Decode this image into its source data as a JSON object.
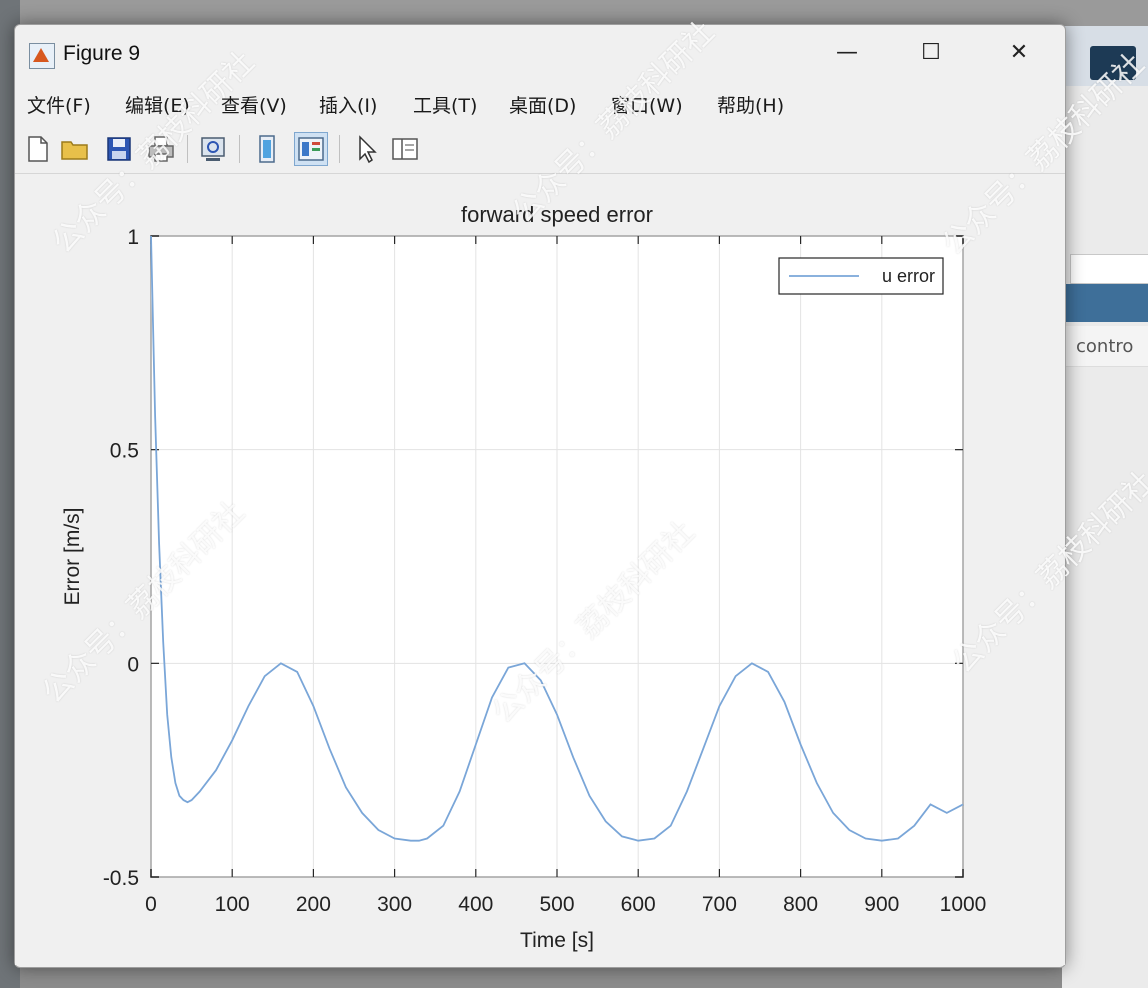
{
  "window": {
    "title": "Figure 9",
    "controls": {
      "minimize": "—",
      "maximize": "☐",
      "close": "✕"
    }
  },
  "menubar": [
    "文件(F)",
    "编辑(E)",
    "查看(V)",
    "插入(I)",
    "工具(T)",
    "桌面(D)",
    "窗口(W)",
    "帮助(H)"
  ],
  "toolbar": [
    "new-figure",
    "open-file",
    "save",
    "print",
    "link-plot",
    "hide-plot-tools",
    "show-plot-tools",
    "edit-plot",
    "open-property-inspector"
  ],
  "background_app": {
    "text": "contro"
  },
  "watermark": {
    "text": "公众号：荔枝科研社"
  },
  "chart_data": {
    "type": "line",
    "title": "forward speed error",
    "xlabel": "Time [s]",
    "ylabel": "Error [m/s]",
    "xlim": [
      0,
      1000
    ],
    "ylim": [
      -0.5,
      1
    ],
    "xticks": [
      "0",
      "100",
      "200",
      "300",
      "400",
      "500",
      "600",
      "700",
      "800",
      "900",
      "1000"
    ],
    "yticks": [
      "-0.5",
      "0",
      "0.5",
      "1"
    ],
    "grid": true,
    "legend": {
      "position": "top-right",
      "entries": [
        "u error"
      ]
    },
    "series": [
      {
        "name": "u error",
        "color": "#7aa6d8",
        "x": [
          0,
          5,
          10,
          15,
          20,
          25,
          30,
          35,
          40,
          45,
          50,
          60,
          80,
          100,
          120,
          140,
          160,
          180,
          200,
          220,
          240,
          260,
          280,
          300,
          320,
          330,
          340,
          360,
          380,
          400,
          420,
          440,
          460,
          480,
          500,
          520,
          540,
          560,
          580,
          600,
          620,
          640,
          660,
          680,
          700,
          720,
          740,
          760,
          780,
          800,
          820,
          840,
          860,
          880,
          900,
          920,
          940,
          960,
          980,
          1000
        ],
        "y": [
          1.0,
          0.58,
          0.28,
          0.05,
          -0.12,
          -0.22,
          -0.28,
          -0.31,
          -0.32,
          -0.325,
          -0.32,
          -0.3,
          -0.25,
          -0.18,
          -0.1,
          -0.03,
          0.0,
          -0.02,
          -0.1,
          -0.2,
          -0.29,
          -0.35,
          -0.39,
          -0.41,
          -0.415,
          -0.415,
          -0.41,
          -0.38,
          -0.3,
          -0.19,
          -0.08,
          -0.01,
          0.0,
          -0.04,
          -0.12,
          -0.22,
          -0.31,
          -0.37,
          -0.405,
          -0.415,
          -0.41,
          -0.38,
          -0.3,
          -0.2,
          -0.1,
          -0.03,
          0.0,
          -0.02,
          -0.09,
          -0.19,
          -0.28,
          -0.35,
          -0.39,
          -0.41,
          -0.415,
          -0.41,
          -0.38,
          -0.33,
          -0.35,
          -0.33
        ]
      }
    ]
  }
}
